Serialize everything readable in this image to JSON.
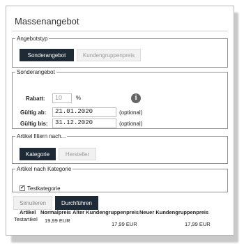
{
  "title": "Massenangebot",
  "angebotstyp": {
    "legend": "Angebotstyp",
    "options": [
      "Sonderangebot",
      "Kundengruppenpreis"
    ]
  },
  "sonderangebot": {
    "legend": "Sonderangebot",
    "rabatt_label": "Rabatt:",
    "rabatt_value": "10",
    "rabatt_unit": "%",
    "gueltig_ab_label": "Gültig ab:",
    "gueltig_ab_value": "21.01.2020",
    "gueltig_bis_label": "Gültig bis:",
    "gueltig_bis_value": "31.12.2020",
    "optional": "(optional)",
    "info_icon": "info-icon"
  },
  "filter": {
    "legend": "Artikel filtern nach...",
    "options": [
      "Kategorie",
      "Hersteller"
    ]
  },
  "kategorie": {
    "legend": "Artikel nach Kategorie",
    "item": "Testkategorie",
    "checked": "✔"
  },
  "actions": {
    "simulate": "Simulieren",
    "execute": "Durchführen"
  },
  "table": {
    "headers": [
      "Artikel",
      "Normalpreis",
      "Alter Kundengruppenpreis",
      "Neuer Kundengruppenpreis"
    ],
    "rows": [
      [
        "Testartikel",
        "19,99 EUR",
        "17,99 EUR",
        "17,99 EUR"
      ]
    ]
  }
}
